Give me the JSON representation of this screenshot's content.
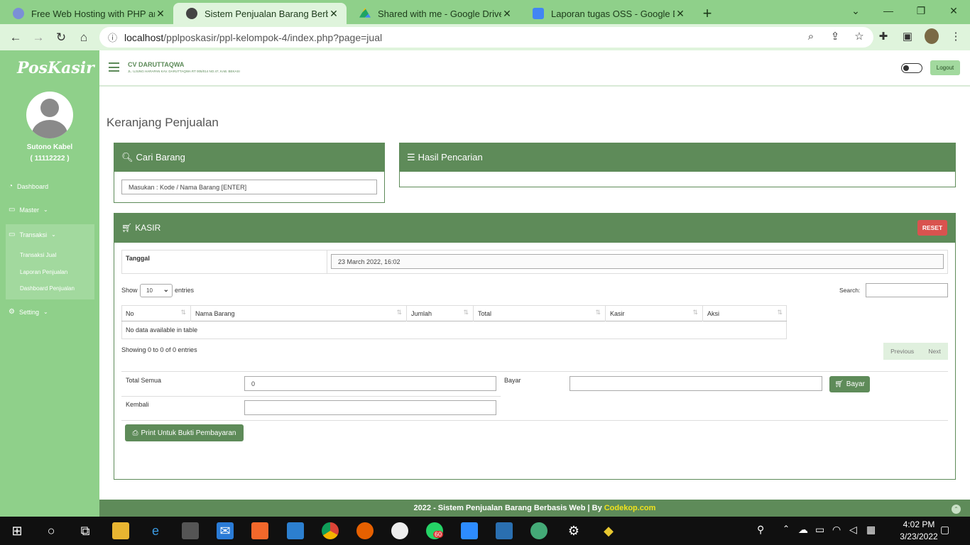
{
  "browser": {
    "tabs": [
      {
        "label": "Free Web Hosting with PHP and",
        "fav": "#7b8fd6"
      },
      {
        "label": "Sistem Penjualan Barang Berbasis",
        "fav": "#444444"
      },
      {
        "label": "Shared with me - Google Drive",
        "fav": "#1fa463"
      },
      {
        "label": "Laporan tugas OSS - Google Doc",
        "fav": "#4285f4"
      }
    ],
    "url_host": "localhost",
    "url_path": "/pplposkasir/ppl-kelompok-4/index.php?page=jual"
  },
  "sidebar": {
    "brand": "PosKasir",
    "user_name": "Sutono Kabel",
    "user_id": "( 11112222 )",
    "menu": {
      "dashboard": "Dashboard",
      "master": "Master",
      "transaksi": "Transaksi",
      "transaksi_jual": "Transaksi Jual",
      "laporan": "Laporan Penjualan",
      "dashboard_penjualan": "Dashboard Penjualan",
      "setting": "Setting"
    }
  },
  "topbar": {
    "company": "CV DARUTTAQWA",
    "address": "JL. UJUNG HARAPAN KAV. DARUTTAQWA RT 005/014 NO.47, KAB. BEKASI",
    "logout": "Logout"
  },
  "page": {
    "title": "Keranjang Penjualan",
    "cari_title": "Cari Barang",
    "cari_placeholder": "Masukan : Kode / Nama Barang  [ENTER]",
    "hasil_title": "Hasil Pencarian",
    "kasir_title": "KASIR",
    "reset": "RESET",
    "tanggal_label": "Tanggal",
    "tanggal_value": "23 March 2022, 16:02",
    "show_label": "Show",
    "show_value": "10",
    "entries_label": "entries",
    "search_label": "Search:",
    "columns": [
      "No",
      "Nama Barang",
      "Jumlah",
      "Total",
      "Kasir",
      "Aksi"
    ],
    "empty_text": "No data available in table",
    "info_text": "Showing 0 to 0 of 0 entries",
    "previous": "Previous",
    "next": "Next",
    "total_label": "Total Semua",
    "total_value": "0",
    "bayar_label": "Bayar",
    "bayar_button": "Bayar",
    "kembali_label": "Kembali",
    "print_button": "Print Untuk Bukti Pembayaran"
  },
  "footer": {
    "text": "2022 - Sistem Penjualan Barang Berbasis Web | By",
    "link": "Codekop.com"
  },
  "taskbar": {
    "time": "4:02 PM",
    "date": "3/23/2022",
    "whatsapp_badge": "60"
  }
}
